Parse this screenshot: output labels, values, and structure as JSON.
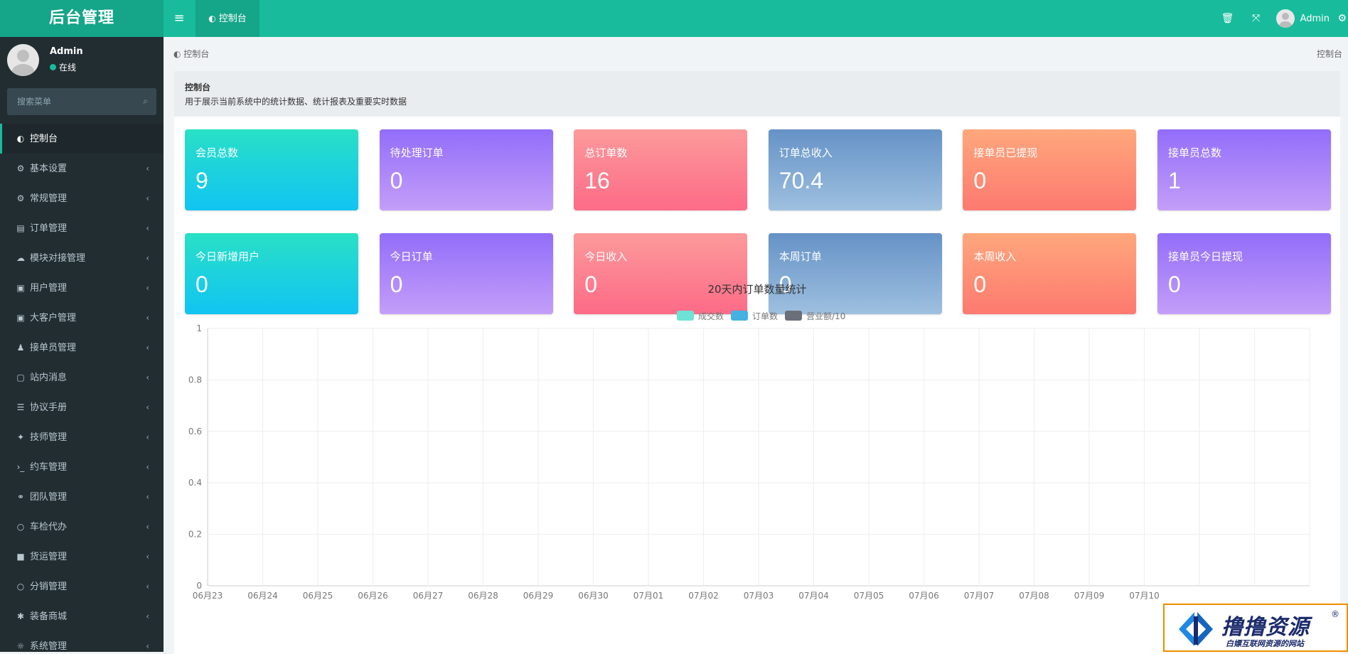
{
  "brand": "后台管理",
  "top_tab": {
    "icon": "dashboard-icon",
    "label": "控制台"
  },
  "top_user": "Admin",
  "sidebar": {
    "user_name": "Admin",
    "status": "在线",
    "search_placeholder": "搜索菜单",
    "items": [
      {
        "label": "控制台",
        "icon": "dashboard-icon",
        "glyph": "◐",
        "active": true
      },
      {
        "label": "基本设置",
        "icon": "gear-icon",
        "glyph": "⚙"
      },
      {
        "label": "常规管理",
        "icon": "cogs-icon",
        "glyph": "⚙"
      },
      {
        "label": "订单管理",
        "icon": "book-icon",
        "glyph": "▤"
      },
      {
        "label": "模块对接管理",
        "icon": "cloud-icon",
        "glyph": "☁"
      },
      {
        "label": "用户管理",
        "icon": "user-card-icon",
        "glyph": "▣"
      },
      {
        "label": "大客户管理",
        "icon": "contact-icon",
        "glyph": "▣"
      },
      {
        "label": "接单员管理",
        "icon": "users-icon",
        "glyph": "♟"
      },
      {
        "label": "站内消息",
        "icon": "message-icon",
        "glyph": "▢"
      },
      {
        "label": "协议手册",
        "icon": "list-icon",
        "glyph": "☰"
      },
      {
        "label": "技师管理",
        "icon": "walk-icon",
        "glyph": "✦"
      },
      {
        "label": "约车管理",
        "icon": "terminal-icon",
        "glyph": "›_"
      },
      {
        "label": "团队管理",
        "icon": "handshake-icon",
        "glyph": "⚭"
      },
      {
        "label": "车检代办",
        "icon": "circle-icon",
        "glyph": "○"
      },
      {
        "label": "货运管理",
        "icon": "truck-icon",
        "glyph": "■"
      },
      {
        "label": "分销管理",
        "icon": "circle-icon",
        "glyph": "○"
      },
      {
        "label": "装备商城",
        "icon": "bug-icon",
        "glyph": "✱"
      },
      {
        "label": "系统管理",
        "icon": "gear-icon",
        "glyph": "☼"
      }
    ]
  },
  "breadcrumb": {
    "left": "控制台",
    "right": "控制台"
  },
  "panel": {
    "title": "控制台",
    "subtitle": "用于展示当前系统中的统计数据、统计报表及重要实时数据"
  },
  "stats": [
    {
      "label": "会员总数",
      "value": "9",
      "style": "g1"
    },
    {
      "label": "待处理订单",
      "value": "0",
      "style": "g2"
    },
    {
      "label": "总订单数",
      "value": "16",
      "style": "g3"
    },
    {
      "label": "订单总收入",
      "value": "70.4",
      "style": "g4"
    },
    {
      "label": "接单员已提现",
      "value": "0",
      "style": "g5"
    },
    {
      "label": "接单员总数",
      "value": "1",
      "style": "g2"
    },
    {
      "label": "今日新增用户",
      "value": "0",
      "style": "g1"
    },
    {
      "label": "今日订单",
      "value": "0",
      "style": "g2"
    },
    {
      "label": "今日收入",
      "value": "0",
      "style": "g3"
    },
    {
      "label": "本周订单",
      "value": "0",
      "style": "g4"
    },
    {
      "label": "本周收入",
      "value": "0",
      "style": "g5"
    },
    {
      "label": "接单员今日提现",
      "value": "0",
      "style": "g2"
    }
  ],
  "chart_data": {
    "type": "bar",
    "title": "20天内订单数量统计",
    "categories": [
      "06月23",
      "06月24",
      "06月25",
      "06月26",
      "06月27",
      "06月28",
      "06月29",
      "06月30",
      "07月01",
      "07月02",
      "07月03",
      "07月04",
      "07月05",
      "07月06",
      "07月07",
      "07月08",
      "07月09",
      "07月10"
    ],
    "series": [
      {
        "name": "成交数",
        "color": "#6ee2d4",
        "values": [
          0,
          0,
          0,
          0,
          0,
          0,
          0,
          0,
          0,
          0,
          0,
          0,
          0,
          0,
          0,
          0,
          0,
          0
        ]
      },
      {
        "name": "订单数",
        "color": "#45b1e0",
        "values": [
          0,
          0,
          0,
          0,
          0,
          0,
          0,
          0,
          0,
          0,
          0,
          0,
          0,
          0,
          0,
          0,
          0,
          0
        ]
      },
      {
        "name": "营业额/10",
        "color": "#6b6f7a",
        "values": [
          0,
          0,
          0,
          0,
          0,
          0,
          0,
          0,
          0,
          0,
          0,
          0,
          0,
          0,
          0,
          0,
          0,
          0
        ]
      }
    ],
    "yticks": [
      "0",
      "0.2",
      "0.4",
      "0.6",
      "0.8",
      "1"
    ],
    "ylim": [
      0,
      1
    ],
    "grid": true,
    "legend": "top-center"
  },
  "watermark": {
    "title": "撸撸资源",
    "subtitle": "白嫖互联网资源的网站",
    "reg": "®"
  }
}
